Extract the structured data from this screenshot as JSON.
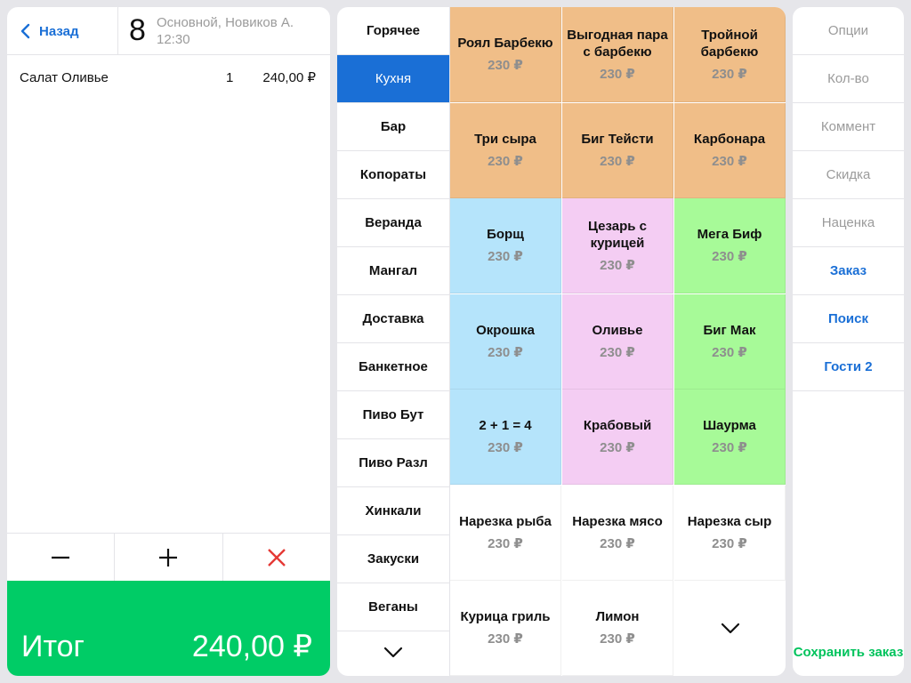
{
  "header": {
    "back_label": "Назад",
    "table_number": "8",
    "table_meta_line1": "Основной, Новиков А.",
    "table_meta_line2": "12:30"
  },
  "order": {
    "items": [
      {
        "name": "Салат Оливье",
        "qty": "1",
        "price": "240,00 ₽"
      }
    ],
    "total_label": "Итог",
    "total_value": "240,00 ₽"
  },
  "actions": [
    "decrease",
    "increase",
    "delete"
  ],
  "categories": [
    "Горячее",
    "Кухня",
    "Бар",
    "Копораты",
    "Веранда",
    "Мангал",
    "Доставка",
    "Банкетное",
    "Пиво Бут",
    "Пиво Разл",
    "Хинкали",
    "Закуски",
    "Веганы"
  ],
  "active_category": "Кухня",
  "menu": [
    {
      "name": "Роял Барбекю",
      "price": "230 ₽",
      "color": "#f0be88"
    },
    {
      "name": "Выгодная пара с барбекю",
      "price": "230 ₽",
      "color": "#f0be88"
    },
    {
      "name": "Тройной барбекю",
      "price": "230 ₽",
      "color": "#f0be88"
    },
    {
      "name": "Три сыра",
      "price": "230 ₽",
      "color": "#f0be88"
    },
    {
      "name": "Биг Тейсти",
      "price": "230 ₽",
      "color": "#f0be88"
    },
    {
      "name": "Карбонара",
      "price": "230 ₽",
      "color": "#f0be88"
    },
    {
      "name": "Борщ",
      "price": "230 ₽",
      "color": "#b5e4fb"
    },
    {
      "name": "Цезарь с курицей",
      "price": "230 ₽",
      "color": "#f4cdf3"
    },
    {
      "name": "Мега Биф",
      "price": "230 ₽",
      "color": "#a7fa98"
    },
    {
      "name": "Окрошка",
      "price": "230 ₽",
      "color": "#b5e4fb"
    },
    {
      "name": "Оливье",
      "price": "230 ₽",
      "color": "#f4cdf3"
    },
    {
      "name": "Биг Мак",
      "price": "230 ₽",
      "color": "#a7fa98"
    },
    {
      "name": "2 + 1 = 4",
      "price": "230 ₽",
      "color": "#b5e4fb"
    },
    {
      "name": "Крабовый",
      "price": "230 ₽",
      "color": "#f4cdf3"
    },
    {
      "name": "Шаурма",
      "price": "230 ₽",
      "color": "#a7fa98"
    },
    {
      "name": "Нарезка рыба",
      "price": "230 ₽",
      "color": "#ffffff"
    },
    {
      "name": "Нарезка мясо",
      "price": "230 ₽",
      "color": "#ffffff"
    },
    {
      "name": "Нарезка сыр",
      "price": "230 ₽",
      "color": "#ffffff"
    },
    {
      "name": "Курица гриль",
      "price": "230 ₽",
      "color": "#ffffff"
    },
    {
      "name": "Лимон",
      "price": "230 ₽",
      "color": "#ffffff"
    }
  ],
  "options": [
    {
      "label": "Опции",
      "style": "gray"
    },
    {
      "label": "Кол-во",
      "style": "gray"
    },
    {
      "label": "Коммент",
      "style": "gray"
    },
    {
      "label": "Скидка",
      "style": "gray"
    },
    {
      "label": "Наценка",
      "style": "gray"
    },
    {
      "label": "Заказ",
      "style": "blue"
    },
    {
      "label": "Поиск",
      "style": "blue"
    },
    {
      "label": "Гости 2",
      "style": "blue"
    }
  ],
  "save_label": "Сохранить заказ",
  "colors": {
    "accent": "#1a6fd6",
    "total_bg": "#00cc66",
    "save": "#00c35c",
    "delete": "#e53935"
  }
}
